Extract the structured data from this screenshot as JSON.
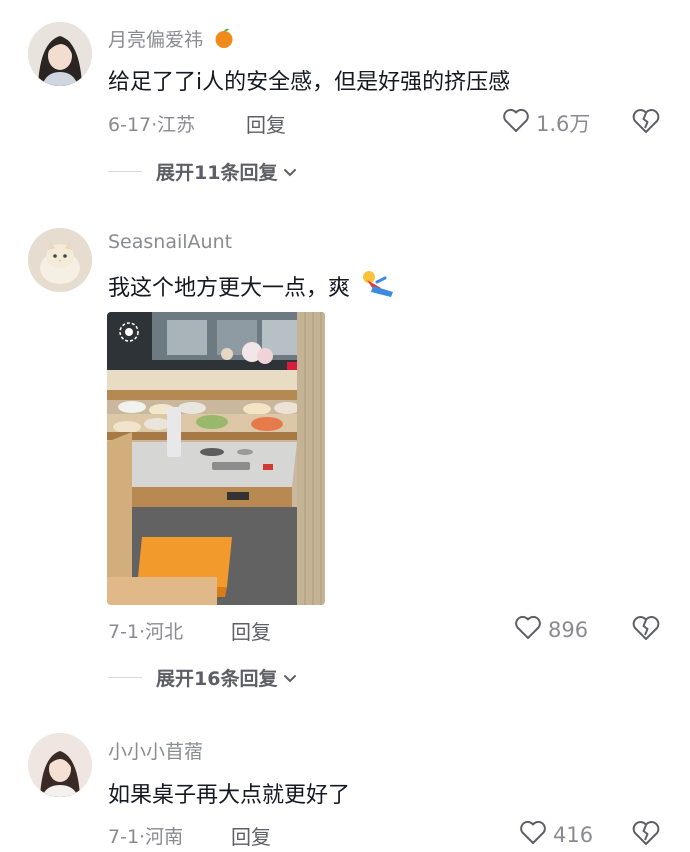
{
  "comments": [
    {
      "username": "月亮偏爱祎",
      "username_emoji": "tangerine-emoji",
      "text": "给足了了i人的安全感，但是好强的挤压感",
      "date": "6-17",
      "location": "江苏",
      "reply_label": "回复",
      "likes": "1.6万",
      "expand_label": "展开11条回复"
    },
    {
      "username": "SeasnailAunt",
      "text": "我这个地方更大一点，爽",
      "text_emoji": "sliding-figure-emoji",
      "has_photo": true,
      "date": "7-1",
      "location": "河北",
      "reply_label": "回复",
      "likes": "896",
      "expand_label": "展开16条回复"
    },
    {
      "username": "小小小苜蓿",
      "text": "如果桌子再大点就更好了",
      "date": "7-1",
      "location": "河南",
      "reply_label": "回复",
      "likes": "416"
    }
  ],
  "icons": {
    "like": "heart-outline-icon",
    "dislike": "broken-heart-icon",
    "expand": "chevron-down-icon"
  },
  "colors": {
    "username": "#8a8b91",
    "text": "#161823",
    "meta": "#8a8b91",
    "expand": "#5e5f66"
  }
}
